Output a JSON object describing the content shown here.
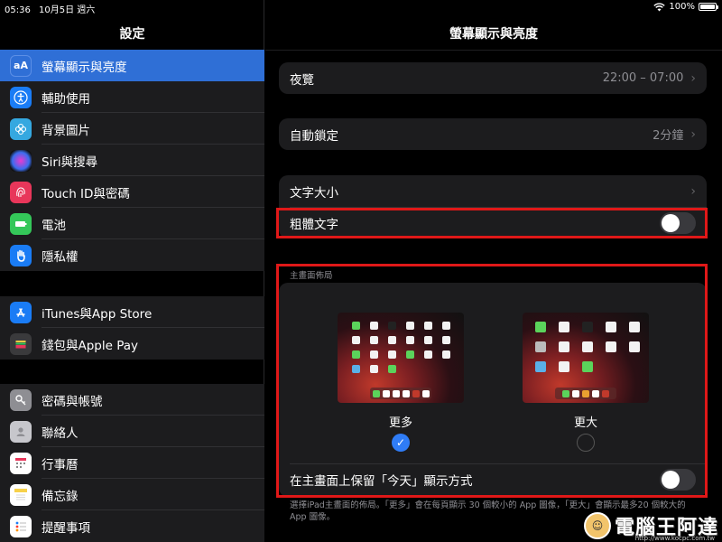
{
  "status": {
    "time": "05:36",
    "date": "10月5日 週六",
    "battery": "100%"
  },
  "sidebar": {
    "title": "設定",
    "groups": [
      [
        {
          "label": "螢幕顯示與亮度",
          "icon": "AA",
          "color": "#2f6fd6",
          "selected": true
        },
        {
          "label": "輔助使用",
          "icon": "accessibility-icon",
          "color": "#1a7cf5"
        },
        {
          "label": "背景圖片",
          "icon": "flower-icon",
          "color": "#35a8e0"
        },
        {
          "label": "Siri與搜尋",
          "icon": "siri-icon",
          "color": "#333"
        },
        {
          "label": "Touch ID與密碼",
          "icon": "fingerprint-icon",
          "color": "#e8365a"
        },
        {
          "label": "電池",
          "icon": "battery-icon",
          "color": "#34c759"
        },
        {
          "label": "隱私權",
          "icon": "hand-icon",
          "color": "#1a7cf5"
        }
      ],
      [
        {
          "label": "iTunes與App Store",
          "icon": "app-store-icon",
          "color": "#1a7cf5"
        },
        {
          "label": "錢包與Apple Pay",
          "icon": "wallet-icon",
          "color": "#333"
        }
      ],
      [
        {
          "label": "密碼與帳號",
          "icon": "key-icon",
          "color": "#8e8e93"
        },
        {
          "label": "聯絡人",
          "icon": "contacts-icon",
          "color": "#a5a5a5"
        },
        {
          "label": "行事曆",
          "icon": "calendar-icon",
          "color": "#fff"
        },
        {
          "label": "備忘錄",
          "icon": "notes-icon",
          "color": "#f7d14a"
        },
        {
          "label": "提醒事項",
          "icon": "reminders-icon",
          "color": "#fff"
        }
      ]
    ]
  },
  "detail": {
    "title": "螢幕顯示與亮度",
    "night_shift": {
      "label": "夜覽",
      "value": "22:00 – 07:00"
    },
    "auto_lock": {
      "label": "自動鎖定",
      "value": "2分鐘"
    },
    "text_size": {
      "label": "文字大小"
    },
    "bold_text": {
      "label": "粗體文字",
      "on": false
    },
    "home_layout": {
      "section": "主畫面佈局",
      "more": "更多",
      "bigger": "更大",
      "selected": "more",
      "keep_today": {
        "label": "在主畫面上保留「今天」顯示方式",
        "on": false
      }
    },
    "footer": "選擇iPad主畫面的佈局。「更多」會在每頁顯示 30 個較小的 App 圖像，「更大」會顯示最多20 個較大的 App 圖像。"
  },
  "watermark": {
    "text": "電腦王阿達",
    "url": "http://www.kocpc.com.tw"
  },
  "colors": {
    "accent": "#2f7cf6",
    "highlight_box": "#e01818"
  }
}
